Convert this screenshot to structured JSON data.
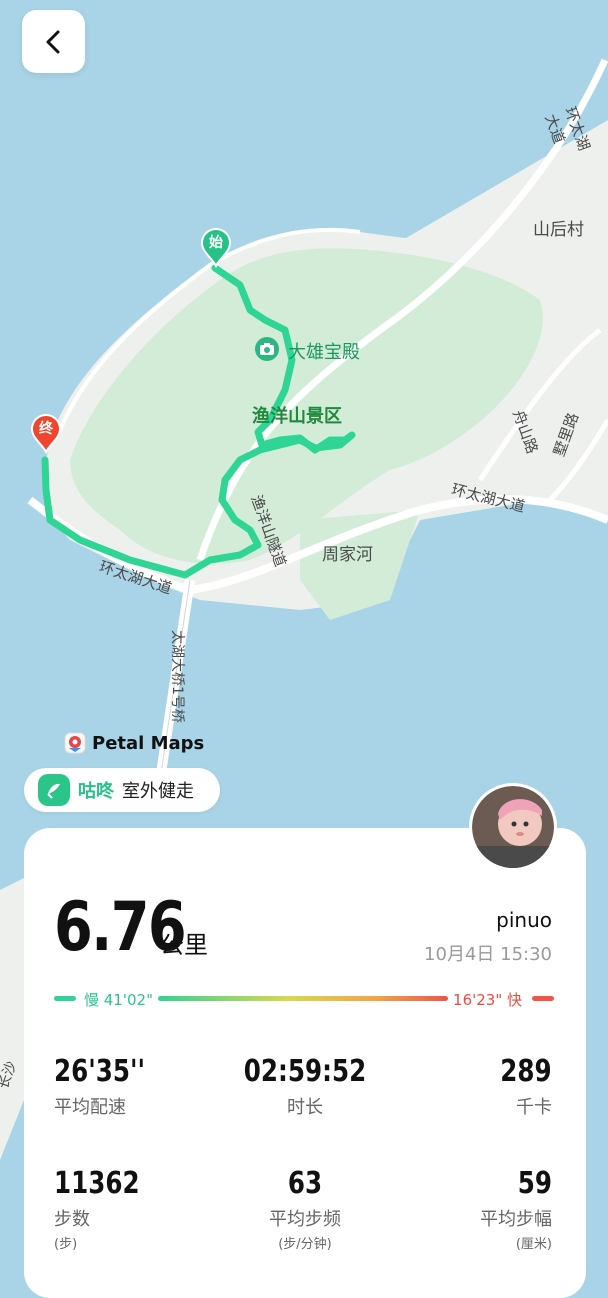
{
  "map": {
    "places": {
      "shanhou_cun": "山后村",
      "daxiong_baodian": "大雄宝殿",
      "yuyangshan_scenic": "渔洋山景区",
      "zhoujiahe": "周家河",
      "huantaihu_road_1": "环太湖大道",
      "huantaihu_road_2": "环太湖大道",
      "huantaihu_road_3": "环太湖大道",
      "zhoushan_road": "舟山路",
      "shuli_road": "墅里路",
      "yuyang_tunnel": "渔洋山隧道",
      "taihu_bridge": "太湖大桥1号桥",
      "chang_fragment": "长沙"
    },
    "start_marker": "始",
    "end_marker": "终",
    "attribution": "Petal Maps",
    "route_color": "#2fd595"
  },
  "app": {
    "name": "咕咚",
    "activity": "室外健走",
    "brand_color": "#25c38a"
  },
  "summary": {
    "distance": "6.76",
    "distance_unit": "公里",
    "username": "pinuo",
    "datetime": "10月4日 15:30",
    "pace_slow": "慢 41'02\"",
    "pace_fast": "16'23\" 快"
  },
  "stats": {
    "avg_pace": {
      "value": "26'35''",
      "label": "平均配速"
    },
    "duration": {
      "value": "02:59:52",
      "label": "时长"
    },
    "calories": {
      "value": "289",
      "label": "千卡"
    },
    "steps": {
      "value": "11362",
      "label": "步数",
      "unit": "(步)"
    },
    "cadence": {
      "value": "63",
      "label": "平均步频",
      "unit": "(步/分钟)"
    },
    "stride": {
      "value": "59",
      "label": "平均步幅",
      "unit": "(厘米)"
    }
  }
}
